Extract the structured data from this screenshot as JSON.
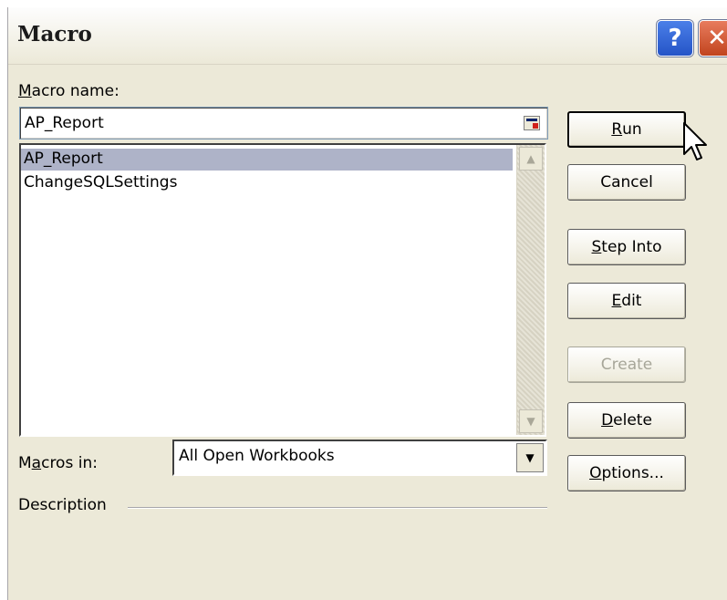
{
  "window": {
    "title": "Macro"
  },
  "titlebar": {
    "help_label": "?",
    "close_label": "✕"
  },
  "form": {
    "macro_name_label": {
      "hotkey": "M",
      "rest": "acro name:"
    },
    "macro_name_value": "AP_Report",
    "macros": [
      "AP_Report",
      "ChangeSQLSettings"
    ],
    "selected_macro": "AP_Report",
    "macros_in_label": {
      "pre": "M",
      "hotkey": "a",
      "rest": "cros in:"
    },
    "macros_in_value": "All Open Workbooks",
    "description_label": "Description"
  },
  "buttons": {
    "run": {
      "hotkey": "R",
      "rest": "un"
    },
    "cancel": "Cancel",
    "step_into": {
      "hotkey": "S",
      "rest": "tep Into"
    },
    "edit": {
      "hotkey": "E",
      "rest": "dit"
    },
    "create": "Create",
    "delete": {
      "hotkey": "D",
      "rest": "elete"
    },
    "options": {
      "hotkey": "O",
      "rest": "ptions..."
    }
  },
  "icons": {
    "scroll_up": "▲",
    "scroll_down": "▼",
    "dropdown": "▼"
  }
}
